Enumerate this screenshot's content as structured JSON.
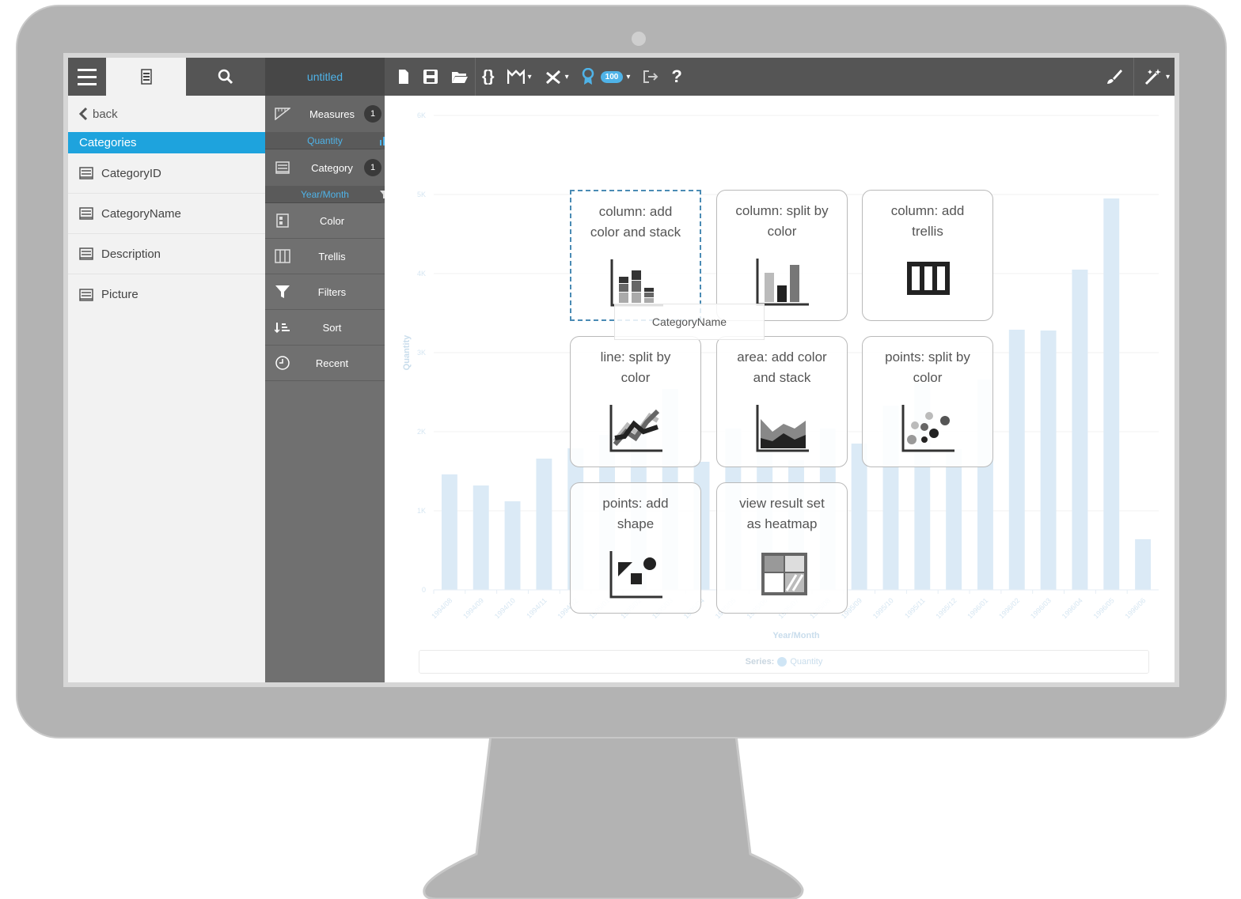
{
  "toolbar": {
    "title": "untitled",
    "badge_value": "100",
    "help_label": "?"
  },
  "left_panel": {
    "back_label": "back",
    "section_header": "Categories",
    "fields": [
      "CategoryID",
      "CategoryName",
      "Description",
      "Picture"
    ]
  },
  "shelves": {
    "measures_label": "Measures",
    "measures_count": "1",
    "measures_pill": "Quantity",
    "category_label": "Category",
    "category_count": "1",
    "category_pill": "Year/Month",
    "color_label": "Color",
    "trellis_label": "Trellis",
    "filters_label": "Filters",
    "sort_label": "Sort",
    "recent_label": "Recent"
  },
  "suggestions": [
    {
      "label": "column: add color and stack",
      "icon": "stacked-column-icon"
    },
    {
      "label": "column: split by color",
      "icon": "grouped-column-icon"
    },
    {
      "label": "column: add trellis",
      "icon": "trellis-icon"
    },
    {
      "label": "line: split by color",
      "icon": "multi-line-icon"
    },
    {
      "label": "area: add color and stack",
      "icon": "stacked-area-icon"
    },
    {
      "label": "points: split by color",
      "icon": "scatter-color-icon"
    },
    {
      "label": "points: add shape",
      "icon": "scatter-shape-icon"
    },
    {
      "label": "view result set as heatmap",
      "icon": "heatmap-icon"
    }
  ],
  "drag_ghost": "CategoryName",
  "colors": {
    "toolbar": "#555555",
    "accent": "#1ea3dd",
    "bar": "#dbeaf6",
    "shelf": "#707070"
  },
  "chart_data": {
    "type": "bar",
    "ylabel": "Quantity",
    "xlabel": "Year/Month",
    "ylim": [
      0,
      6000
    ],
    "yticks": [
      "0",
      "1K",
      "2K",
      "3K",
      "4K",
      "5K",
      "6K"
    ],
    "categories": [
      "1994/08",
      "1994/09",
      "1994/10",
      "1994/11",
      "1994/12",
      "1995/01",
      "1995/02",
      "1995/03",
      "1995/04",
      "1995/05",
      "1995/06",
      "1995/07",
      "1995/08",
      "1995/09",
      "1995/10",
      "1995/11",
      "1995/12",
      "1996/01",
      "1996/02",
      "1996/03",
      "1996/04",
      "1996/05",
      "1996/06"
    ],
    "series": [
      {
        "name": "Quantity",
        "values": [
          1460,
          1320,
          1120,
          1660,
          1790,
          1960,
          2150,
          2540,
          1620,
          2040,
          2040,
          1640,
          2040,
          1850,
          2330,
          2620,
          1780,
          2660,
          3290,
          3280,
          4050,
          4950,
          640
        ]
      }
    ],
    "legend_title": "Series:",
    "legend": "top-bottom"
  }
}
